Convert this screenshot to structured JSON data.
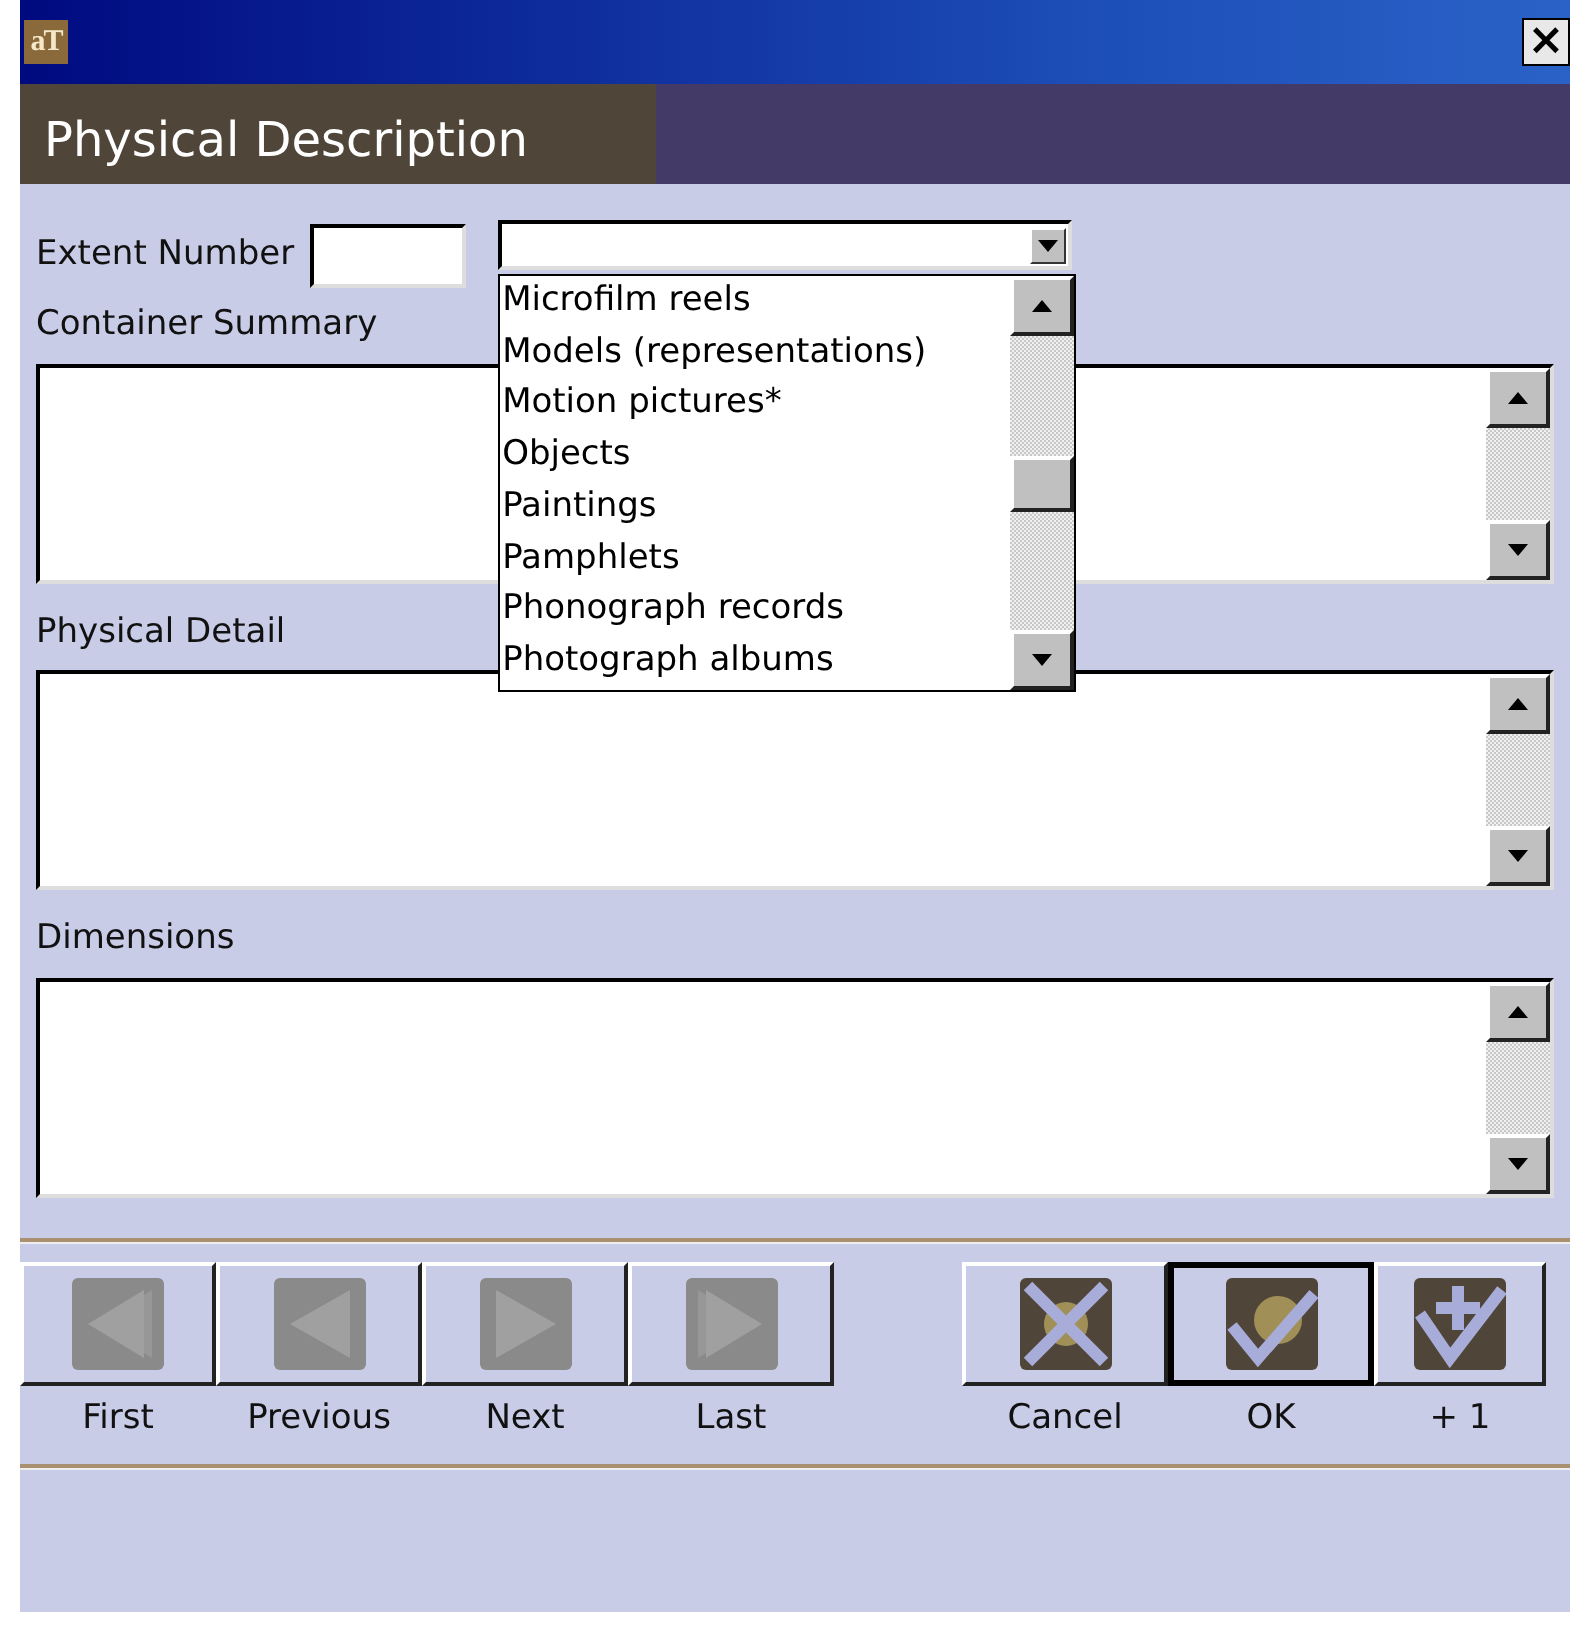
{
  "window": {
    "logo": "aT",
    "close": "×"
  },
  "header": {
    "title": "Physical Description"
  },
  "extent_number": {
    "label": "Extent Number"
  },
  "extent_type": {
    "open": true,
    "options": [
      "Microfilm reels",
      "Models (representations)",
      "Motion pictures*",
      "Objects",
      "Paintings",
      "Pamphlets",
      "Phonograph records",
      "Photograph albums"
    ]
  },
  "fields": [
    {
      "label": "Container Summary"
    },
    {
      "label": "Physical Detail"
    },
    {
      "label": "Dimensions"
    }
  ],
  "navigation": [
    {
      "kind": "first",
      "label": "First",
      "disabled": true
    },
    {
      "kind": "previous",
      "label": "Previous",
      "disabled": true
    },
    {
      "kind": "next",
      "label": "Next",
      "disabled": true
    },
    {
      "kind": "last",
      "label": "Last",
      "disabled": true
    }
  ],
  "actions": [
    {
      "kind": "cancel",
      "label": "Cancel",
      "default": false
    },
    {
      "kind": "ok",
      "label": "OK",
      "default": true
    },
    {
      "kind": "plus",
      "label": "+ 1",
      "default": false
    }
  ]
}
